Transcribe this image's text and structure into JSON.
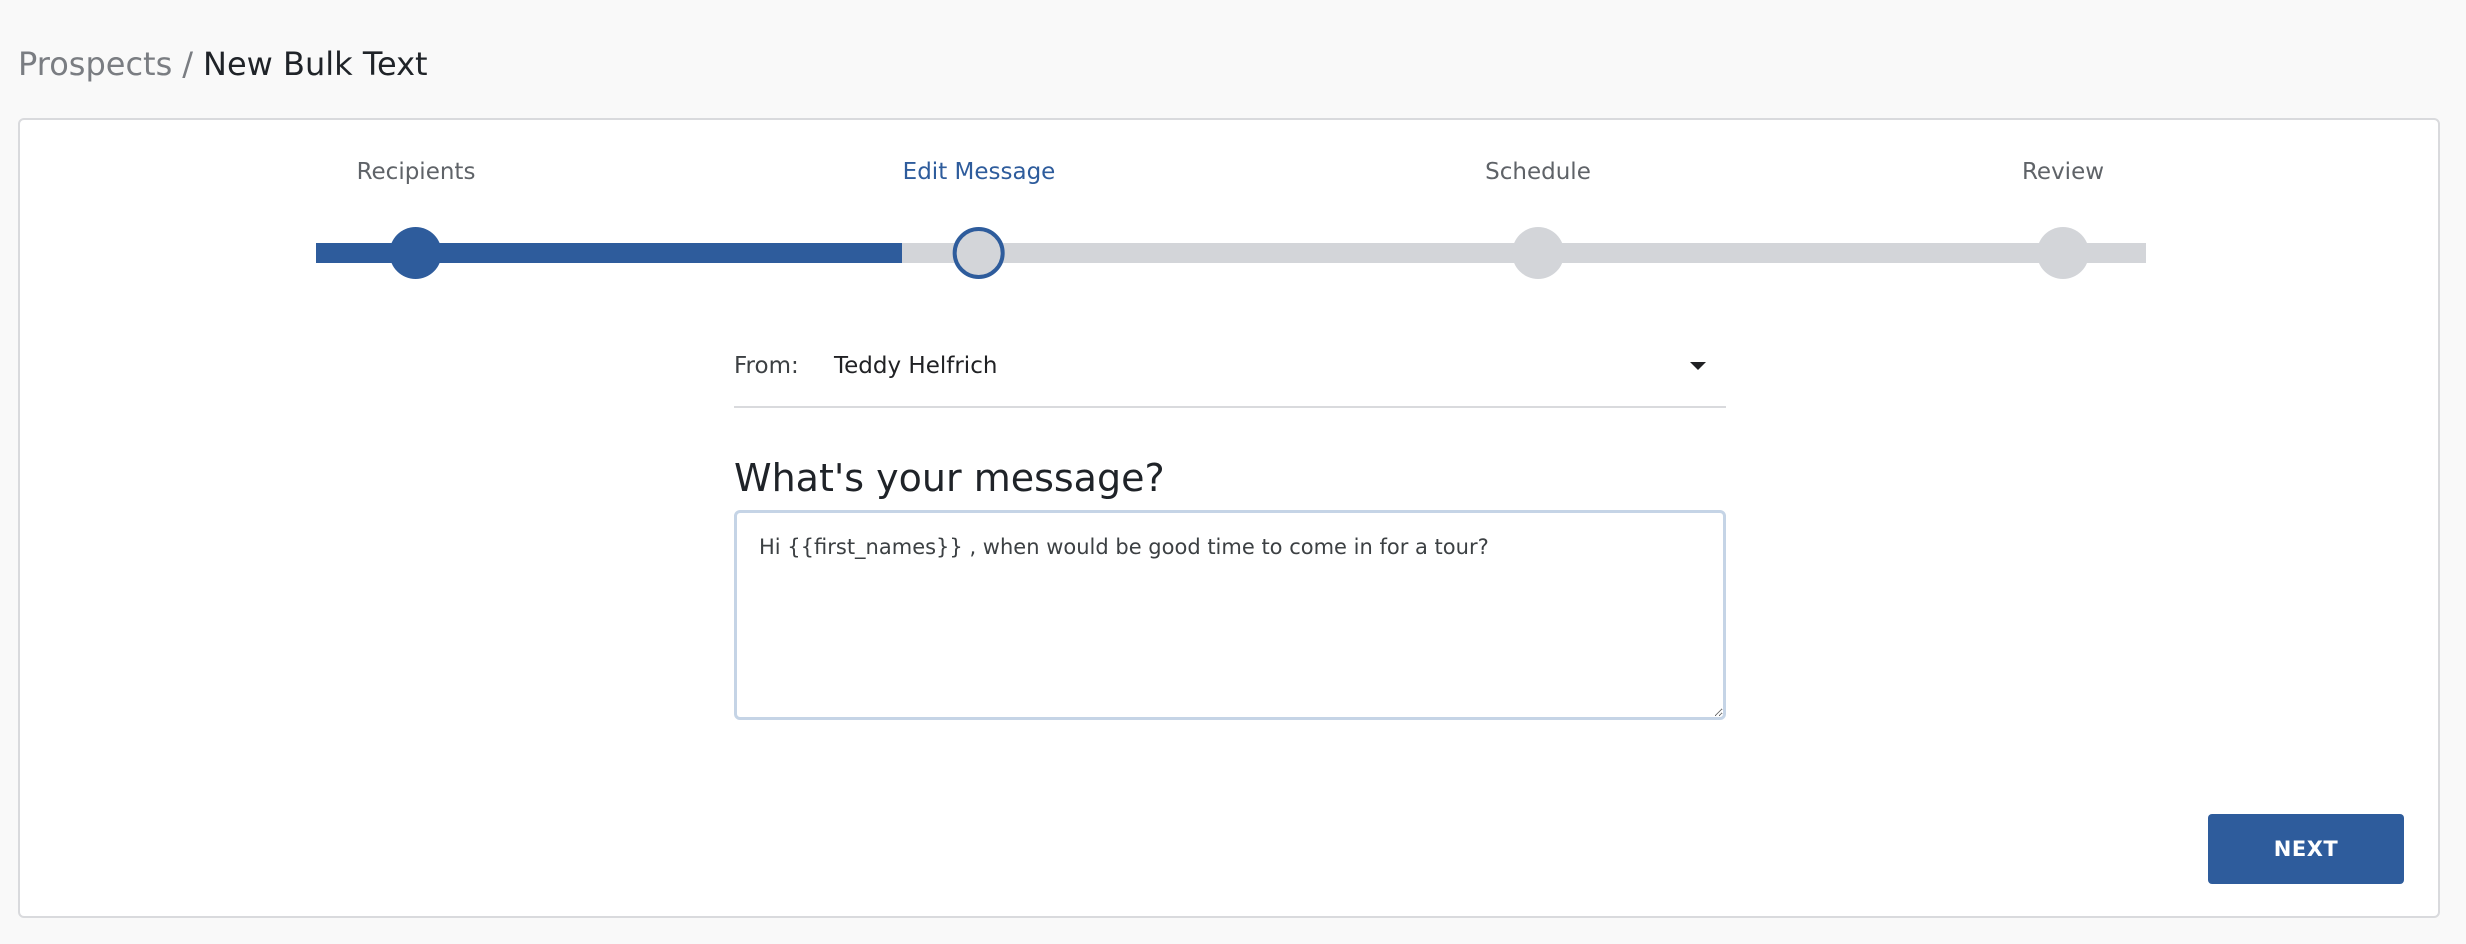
{
  "breadcrumb": {
    "parent": "Prospects",
    "separator": "/",
    "current": "New Bulk Text"
  },
  "stepper": {
    "progress_fraction": 0.32,
    "steps": [
      {
        "label": "Recipients",
        "state": "done"
      },
      {
        "label": "Edit Message",
        "state": "current"
      },
      {
        "label": "Schedule",
        "state": "pending"
      },
      {
        "label": "Review",
        "state": "pending"
      }
    ]
  },
  "form": {
    "from_label": "From:",
    "from_value": "Teddy Helfrich",
    "message_heading": "What's your message?",
    "message_value": "Hi {{first_names}} , when would be good time to come in for a tour?"
  },
  "actions": {
    "next_label": "NEXT"
  },
  "colors": {
    "accent": "#2e5c9c",
    "track": "#d3d5d9",
    "background": "#f9f9f9"
  }
}
